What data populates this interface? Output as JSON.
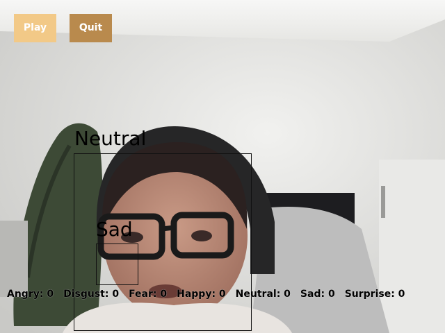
{
  "controls": {
    "play_label": "Play",
    "quit_label": "Quit"
  },
  "detections": {
    "face_label": "Neutral",
    "eye_label": "Sad"
  },
  "counts": [
    {
      "label": "Angry: 0"
    },
    {
      "label": "Disgust: 0"
    },
    {
      "label": "Fear: 0"
    },
    {
      "label": "Happy: 0"
    },
    {
      "label": "Neutral: 0"
    },
    {
      "label": "Sad: 0"
    },
    {
      "label": "Surprise: 0"
    }
  ],
  "colors": {
    "play_button": "#f2c987",
    "quit_button": "#b98a4d",
    "box_stroke": "#111111"
  }
}
